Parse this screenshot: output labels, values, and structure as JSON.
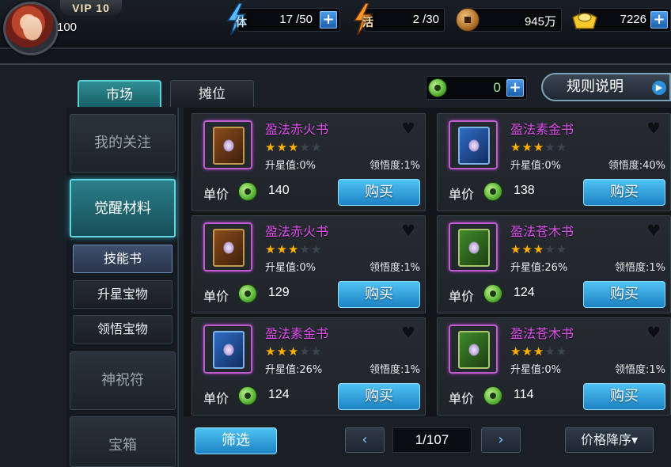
{
  "player": {
    "vip": "VIP 10",
    "level": "100"
  },
  "stats": {
    "stamina": {
      "glyph": "体",
      "value": "17 /50",
      "icon": "lightning-icon"
    },
    "vigor": {
      "glyph": "活",
      "value": "2 /30",
      "icon": "lightning-icon"
    },
    "copper": {
      "value": "945万",
      "icon": "coin-icon"
    },
    "gold": {
      "value": "7226",
      "icon": "gold-ingot-icon"
    }
  },
  "tabs": {
    "market": "市场",
    "stall": "摊位"
  },
  "jade": {
    "value": "0"
  },
  "rules_label": "规则说明",
  "sidebar": {
    "follow": "我的关注",
    "awaken": "觉醒材料",
    "skill_book": "技能书",
    "star_treasure": "升星宝物",
    "insight_treasure": "领悟宝物",
    "blessing": "神祝符",
    "chest": "宝箱"
  },
  "price_label": "单价",
  "buy_label": "购买",
  "items": [
    {
      "name": "盈法赤火书",
      "stars": 3,
      "upgrade": "升星值:0%",
      "comprehension": "领悟度:1%",
      "price": "140",
      "cover": "red"
    },
    {
      "name": "盈法素金书",
      "stars": 3,
      "upgrade": "升星值:0%",
      "comprehension": "领悟度:40%",
      "price": "138",
      "cover": "blue"
    },
    {
      "name": "盈法赤火书",
      "stars": 3,
      "upgrade": "升星值:0%",
      "comprehension": "领悟度:1%",
      "price": "129",
      "cover": "red"
    },
    {
      "name": "盈法苍木书",
      "stars": 3,
      "upgrade": "升星值:26%",
      "comprehension": "领悟度:1%",
      "price": "124",
      "cover": "green"
    },
    {
      "name": "盈法素金书",
      "stars": 3,
      "upgrade": "升星值:26%",
      "comprehension": "领悟度:1%",
      "price": "124",
      "cover": "blue"
    },
    {
      "name": "盈法苍木书",
      "stars": 3,
      "upgrade": "升星值:0%",
      "comprehension": "领悟度:1%",
      "price": "114",
      "cover": "green"
    }
  ],
  "bottom": {
    "filter": "筛选",
    "prev": "‹",
    "next": "›",
    "page": "1/107",
    "sort": "价格降序▾"
  },
  "colors": {
    "accent": "#4fc3f2",
    "item_name": "#e353f2",
    "star": "#ffb000",
    "active_tab": "#2f8e94"
  }
}
